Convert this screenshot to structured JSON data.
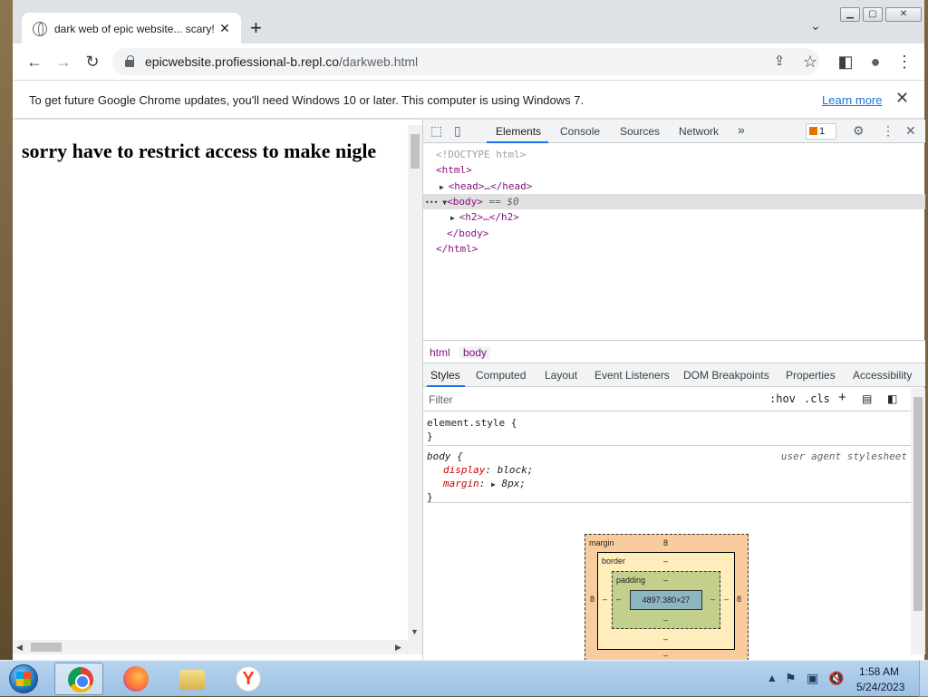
{
  "browser": {
    "tab": {
      "title": "dark web of epic website... scary!",
      "close": "✕"
    },
    "new_tab": "+",
    "tab_search": "⌄",
    "window_controls": {
      "minimize": "▁",
      "maximize": "▢",
      "close": "✕"
    },
    "url": {
      "host": "epicwebsite.profiessional-b.repl.co",
      "path": "/darkweb.html"
    },
    "nav": {
      "back": "←",
      "forward": "→",
      "reload": "↻",
      "share": "⇪",
      "bookmark": "☆",
      "sidepanel": "◧",
      "profile": "●",
      "menu": "⋮"
    }
  },
  "infobar": {
    "text": "To get future Google Chrome updates, you'll need Windows 10 or later. This computer is using Windows 7.",
    "link": "Learn more",
    "close": "✕"
  },
  "page": {
    "heading": "sorry have to restrict access to make nigle"
  },
  "devtools": {
    "tabs": [
      "Elements",
      "Console",
      "Sources",
      "Network"
    ],
    "more_tabs": "»",
    "issues_count": "1",
    "dom": {
      "doctype": "<!DOCTYPE html>",
      "html_open": "<html>",
      "head": "<head>…</head>",
      "body_open": "<body>",
      "body_marker": "== $0",
      "h2": "<h2>…</h2>",
      "body_close": "</body>",
      "html_close": "</html>"
    },
    "breadcrumbs": [
      "html",
      "body"
    ],
    "sub_tabs": [
      "Styles",
      "Computed",
      "Layout",
      "Event Listeners",
      "DOM Breakpoints",
      "Properties",
      "Accessibility"
    ],
    "filter_placeholder": "Filter",
    "filter_buttons": {
      "hov": ":hov",
      "cls": ".cls",
      "add": "+"
    },
    "rules": {
      "element_style": {
        "selector": "element.style {",
        "close": "}"
      },
      "body": {
        "selector": "body {",
        "source": "user agent stylesheet",
        "props": [
          {
            "name": "display",
            "value": "block;"
          },
          {
            "name": "margin",
            "value": "8px;"
          }
        ],
        "close": "}"
      }
    },
    "box_model": {
      "margin_label": "margin",
      "margin_top": "8",
      "margin_left": "8",
      "margin_right": "8",
      "margin_bottom": "–",
      "border_label": "border",
      "border_top": "–",
      "border_left": "–",
      "border_right": "–",
      "border_bottom": "–",
      "padding_label": "padding",
      "padding_top": "–",
      "padding_left": "–",
      "padding_right": "–",
      "padding_bottom": "–",
      "content": "4897.380×27"
    }
  },
  "taskbar": {
    "apps": [
      "chrome",
      "firefox",
      "explorer",
      "yandex"
    ],
    "yandex_glyph": "Y",
    "tray_arrow": "▲",
    "time": "1:58 AM",
    "date": "5/24/2023"
  }
}
